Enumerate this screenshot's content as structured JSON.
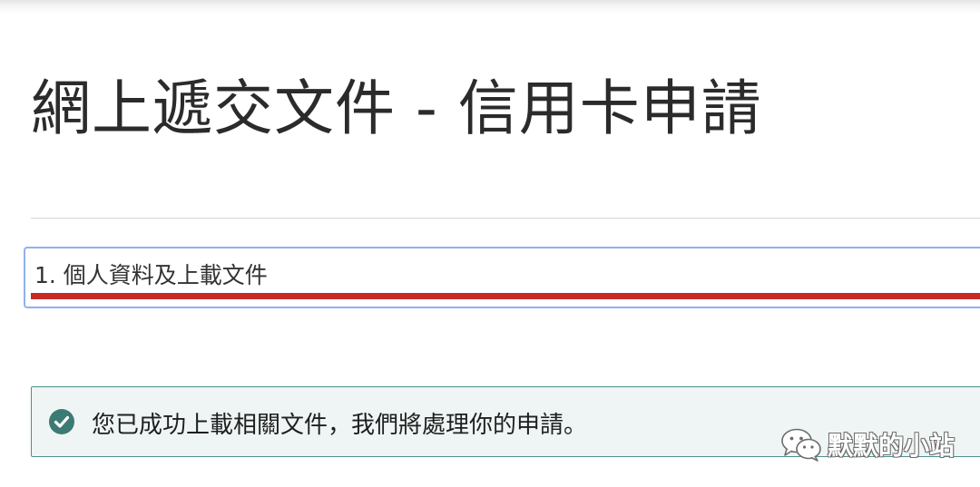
{
  "page": {
    "title": "網上遞交文件 - 信用卡申請"
  },
  "step": {
    "label": "1. 個人資料及上載文件"
  },
  "alert": {
    "icon": "check-circle-icon",
    "message": "您已成功上載相關文件，我們將處理你的申請。"
  },
  "watermark": {
    "icon": "wechat-icon",
    "text": "默默的小站"
  },
  "colors": {
    "step_bar": "#c72a25",
    "step_focus_border": "#8fb1ee",
    "alert_border": "#4f8f8a",
    "alert_background": "#eef5f4",
    "check_icon": "#3b7b74"
  }
}
